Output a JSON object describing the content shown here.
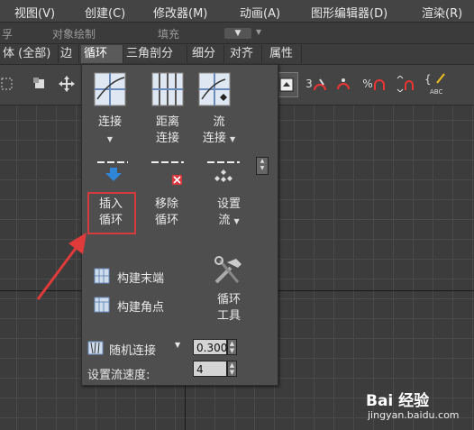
{
  "menubar": {
    "items": [
      "视图(V)",
      "创建(C)",
      "修改器(M)",
      "动画(A)",
      "图形编辑器(D)",
      "渲染(R)"
    ]
  },
  "subbar": {
    "left_text": "孚",
    "object_paint": "对象绘制",
    "fill": "填充",
    "dropdown_glyph": "▾"
  },
  "tabs": [
    "体 (全部)",
    "边",
    "循环",
    "三角剖分",
    "细分",
    "对齐",
    "属性"
  ],
  "active_tab": "循环",
  "toolbar": {
    "labels": [
      "3",
      "%",
      "ABC"
    ]
  },
  "panel": {
    "connect": "连接",
    "distance_connect_1": "距离",
    "distance_connect_2": "连接",
    "flow_connect_1": "流",
    "flow_connect_2": "连接",
    "insert_loop_1": "插入",
    "insert_loop_2": "循环",
    "remove_loop_1": "移除",
    "remove_loop_2": "循环",
    "set_flow_1": "设置",
    "set_flow_2": "流",
    "build_end": "构建末端",
    "build_corner": "构建角点",
    "loop_tools_1": "循环",
    "loop_tools_2": "工具",
    "random_connect": "随机连接",
    "random_connect_value": "0.300",
    "set_flow_speed": "设置流速度:",
    "set_flow_speed_value": "4"
  },
  "colors": {
    "highlight_box": "#d73a3a",
    "arrow": "#e03a3a",
    "blue_arrow": "#2f86d8",
    "red_x": "#d9383f"
  },
  "watermark": {
    "logo": "Bai 经验",
    "url": "jingyan.baidu.com"
  }
}
